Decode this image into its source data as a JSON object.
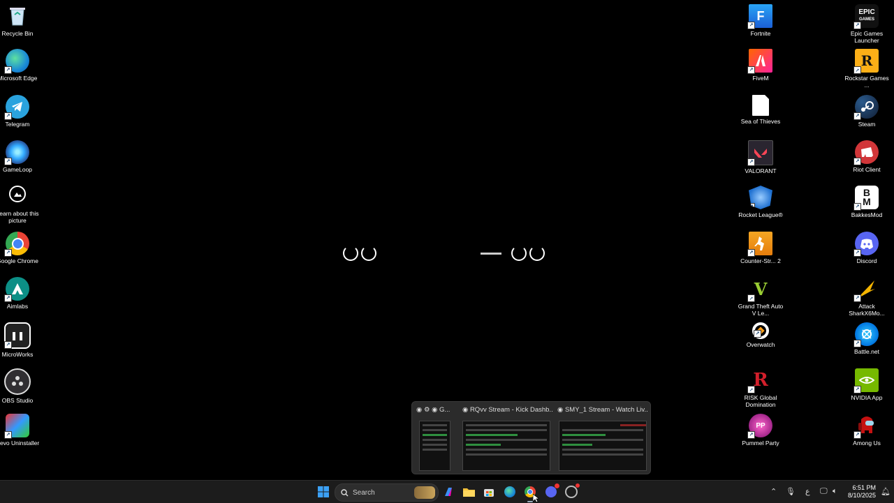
{
  "desktop": {
    "left_icons": [
      {
        "label": "Recycle Bin",
        "icon": "recycle-bin-icon"
      },
      {
        "label": "Microsoft Edge",
        "icon": "edge-icon"
      },
      {
        "label": "Telegram",
        "icon": "telegram-icon"
      },
      {
        "label": "GameLoop",
        "icon": "gameloop-icon"
      },
      {
        "label": "Learn about this picture",
        "icon": "camera-icon"
      },
      {
        "label": "Google Chrome",
        "icon": "chrome-icon"
      },
      {
        "label": "Aimlabs",
        "icon": "aimlabs-icon"
      },
      {
        "label": "MicroWorks",
        "icon": "microworks-icon"
      },
      {
        "label": "OBS Studio",
        "icon": "obs-icon"
      },
      {
        "label": "Revo Uninstaller",
        "icon": "revo-icon"
      }
    ],
    "mid_icons": [
      {
        "label": "Fortnite",
        "icon": "fortnite-icon"
      },
      {
        "label": "FiveM",
        "icon": "fivem-icon"
      },
      {
        "label": "Sea of Thieves",
        "icon": "file-icon"
      },
      {
        "label": "VALORANT",
        "icon": "valorant-icon"
      },
      {
        "label": "Rocket League®",
        "icon": "rocket-league-icon"
      },
      {
        "label": "Counter-Str... 2",
        "icon": "counter-strike-icon"
      },
      {
        "label": "Grand Theft Auto V Le...",
        "icon": "gta-icon"
      },
      {
        "label": "Overwatch",
        "icon": "overwatch-icon"
      },
      {
        "label": "RISK Global Domination",
        "icon": "risk-icon"
      },
      {
        "label": "Pummel Party",
        "icon": "pummel-party-icon"
      }
    ],
    "right_icons": [
      {
        "label": "Epic Games Launcher",
        "icon": "epic-icon"
      },
      {
        "label": "Rockstar Games ...",
        "icon": "rockstar-icon"
      },
      {
        "label": "Steam",
        "icon": "steam-icon"
      },
      {
        "label": "Riot Client",
        "icon": "riot-icon"
      },
      {
        "label": "BakkesMod",
        "icon": "bakkesmod-icon"
      },
      {
        "label": "Discord",
        "icon": "discord-icon"
      },
      {
        "label": "Attack SharkX6Mo...",
        "icon": "shark-icon"
      },
      {
        "label": "Battle.net",
        "icon": "battlenet-icon"
      },
      {
        "label": "NVIDIA App",
        "icon": "nvidia-icon"
      },
      {
        "label": "Among Us",
        "icon": "among-us-icon"
      }
    ]
  },
  "preview": {
    "tabs": [
      {
        "label": "G..."
      },
      {
        "label": "RQvv Stream - Kick Dashb..."
      },
      {
        "label": "SMY_1 Stream - Watch Liv..."
      }
    ]
  },
  "taskbar": {
    "search_label": "Search",
    "tray_lang": "ع",
    "time": "6:51 PM",
    "date": "8/10/2025"
  },
  "colors": {
    "taskbar_bg": "#1c1c1c",
    "accent": "#0078d4"
  }
}
